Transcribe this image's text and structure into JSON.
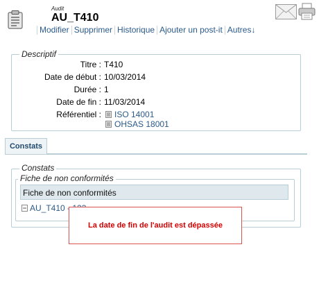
{
  "header": {
    "record_type": "Audit",
    "title": "AU_T410",
    "icons": {
      "record": "clipboard-icon",
      "mail": "mail-icon",
      "print": "print-icon"
    }
  },
  "actions": [
    {
      "label": "Modifier"
    },
    {
      "label": "Supprimer"
    },
    {
      "label": "Historique"
    },
    {
      "label": "Ajouter un post-it"
    },
    {
      "label": "Autres↓"
    }
  ],
  "descriptif": {
    "legend": "Descriptif",
    "fields": {
      "titre": {
        "label": "Titre :",
        "value": "T410"
      },
      "date_debut": {
        "label": "Date de début :",
        "value": "10/03/2014"
      },
      "duree": {
        "label": "Durée :",
        "value": "1"
      },
      "date_fin": {
        "label": "Date de fin :",
        "value": "11/03/2014"
      },
      "referentiel": {
        "label": "Référentiel :",
        "values": [
          "ISO 14001",
          "OHSAS 18001"
        ]
      }
    }
  },
  "tabs": [
    {
      "label": "Constats",
      "active": true
    }
  ],
  "constats": {
    "legend": "Constats",
    "fnc": {
      "legend": "Fiche de non conformités",
      "column_header": "Fiche de non conformités",
      "rows": [
        {
          "label": "AU_T410 - 123"
        }
      ]
    }
  },
  "alert": {
    "message": "La date de fin de l'audit est dépassée"
  },
  "colors": {
    "link": "#2b5a8a",
    "border": "#b8cdd6",
    "alert": "#d40000"
  }
}
